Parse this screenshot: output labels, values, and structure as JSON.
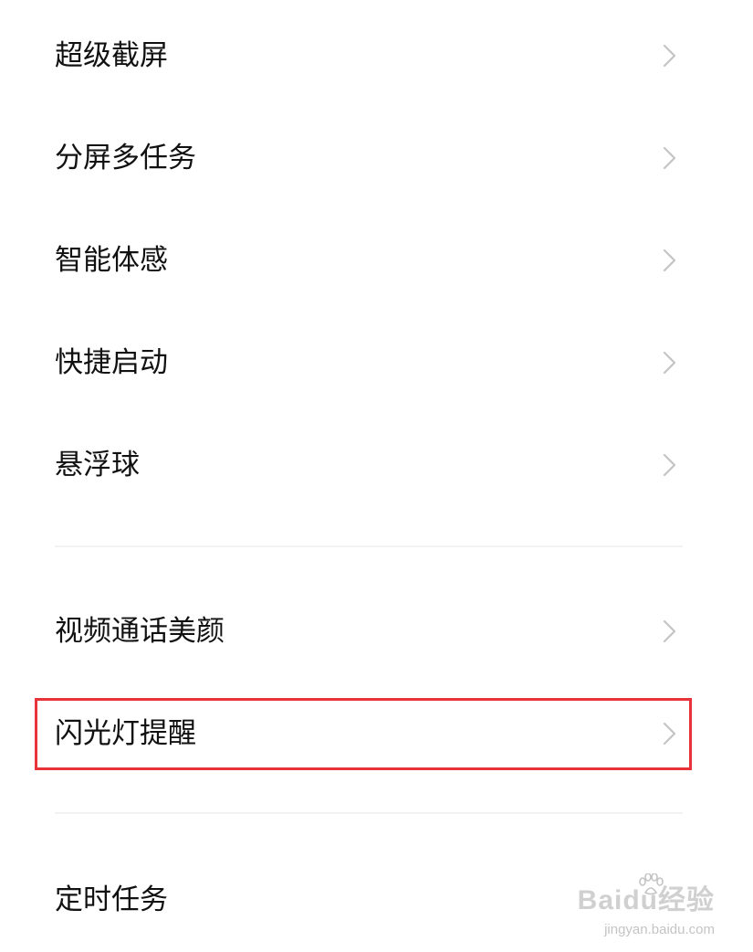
{
  "settings": {
    "group1": [
      {
        "label": "超级截屏"
      },
      {
        "label": "分屏多任务"
      },
      {
        "label": "智能体感"
      },
      {
        "label": "快捷启动"
      },
      {
        "label": "悬浮球"
      }
    ],
    "group2": [
      {
        "label": "视频通话美颜"
      },
      {
        "label": "闪光灯提醒"
      }
    ],
    "group3": [
      {
        "label": "定时任务"
      }
    ]
  },
  "highlight": {
    "target": "闪光灯提醒",
    "color": "#e8333a"
  },
  "watermark": {
    "brand": "Baidu经验",
    "url": "jingyan.baidu.com"
  },
  "icons": {
    "row_chevron": "chevron-right-icon",
    "watermark_logo": "paw-icon"
  },
  "colors": {
    "background": "#ffffff",
    "text": "#111111",
    "chevron": "#c4c4c4",
    "divider": "#f2f2f2"
  }
}
